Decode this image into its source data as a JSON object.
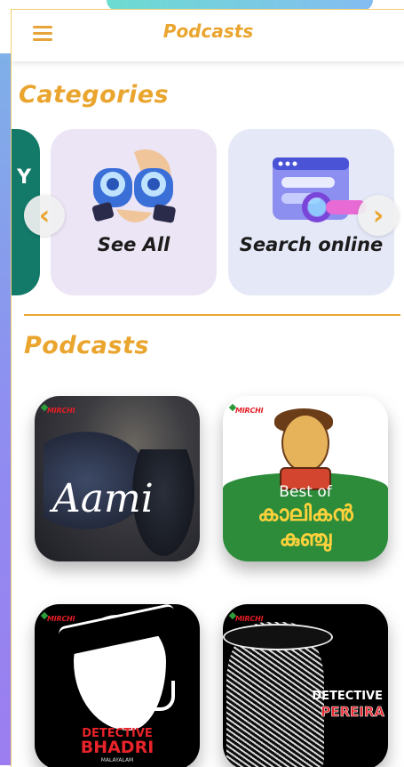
{
  "appbar": {
    "title": "Podcasts",
    "menu_icon": "hamburger-menu-icon"
  },
  "categories": {
    "heading": "Categories",
    "partial_label": "Y",
    "items": [
      {
        "label": "See All",
        "icon": "binoculars-icon"
      },
      {
        "label": "Search online",
        "icon": "search-browser-icon"
      }
    ],
    "prev_arrow": "‹",
    "next_arrow": "›"
  },
  "podcasts": {
    "heading": "Podcasts",
    "items": [
      {
        "logo": "MIRCHI",
        "title": "Aami"
      },
      {
        "logo": "MIRCHI",
        "title_top": "Best of",
        "title_line1": "കാലികൻ",
        "title_line2": "കുഞ്ചു"
      },
      {
        "logo": "MIRCHI",
        "title_top": "DETECTIVE",
        "title_line1": "BHADRI",
        "language": "MALAYALAM"
      },
      {
        "logo": "MIRCHI",
        "title_top": "DETECTIVE",
        "title_line1": "PEREIRA"
      }
    ]
  },
  "colors": {
    "accent": "#eaa52f",
    "card_bg": "#ece6f6",
    "partial_card": "#137a6a"
  }
}
